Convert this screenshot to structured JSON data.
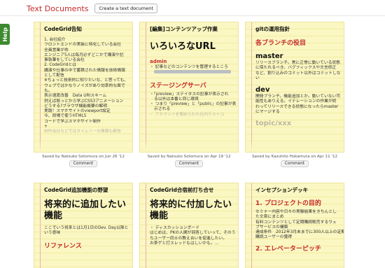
{
  "help_tab": {
    "label": "Help"
  },
  "header": {
    "title": "Text Documents",
    "create_button": "Create a text document"
  },
  "cards": [
    {
      "title": "CodeGrid告知",
      "lines": [
        "1. 会社紹介",
        "フロントエンドの実装に特化している会社",
        "全員営業が命",
        "エンジニア5人は毎月必ずどこかで講演や記",
        "事執筆をしている会社",
        "2. CodeGridとは",
        "講演や仕事の中で蓄積された情報を技術情報",
        "として配信",
        "※ちょっと技術的に知りたいな、と思っても、",
        "ウェブではかなりノイズがあり効率的な面で",
        "も。",
        "表示速度改善　Data URIスキーム",
        "例えば既っとから学ぶCSS3アニメーション",
        "どうする?ブラウザ機能概要の解明",
        "実践！スマホサイトのviewport設定",
        "今、即場で使うHTML5",
        "コードで学ぶスマホサイト制作",
        "+",
        "制作会社などではタイムリーな情報も配信"
      ],
      "saved_by": "Saved by Natsuko Sotomura on Jun 26 '12",
      "comment": "Comment"
    },
    {
      "title": "[編集]コンテンツアップ作業",
      "heading": "いろいろなURL",
      "admin_label": "admin",
      "admin_line": "・ 記事などのコンテンツを管理するところ",
      "section": "ステージングサーバ",
      "bullets": [
        "・「preview」ステイタスの記事が表示され",
        "る以外は本番と同じ環境",
        "・ つまり「preview」と「public」の記事が表",
        "示される",
        "・ アカウントを閉められた社内テストコ"
      ],
      "saved_by": "Saved by Natsuko Sotomura on Apr 19 '12",
      "comment": "Comment"
    },
    {
      "title": "gitの運用指針",
      "section": "各ブランチの役目",
      "master_heading": "master",
      "master_lines": [
        "リリースブランチ。常に正常に動いている状態",
        "に保たれるべき。バグフィックスや文言修正",
        "など、割り込みのコミット以外はコミットしな",
        "い"
      ],
      "dev_heading": "dev",
      "dev_lines": [
        "開発ブランチ。機能追加とか。動いていない可",
        "能性もありえる。イテレーションの作業が終",
        "わってリリースできる状態になったらmaster",
        "にマージする"
      ],
      "topic_heading": "topic/xxx",
      "saved_by": "Saved by Kazuhito Hokamura on Apr 11 '12",
      "comment": "Comment"
    },
    {
      "title": "CodeGrid追加機能の野望",
      "heading": "将来的に追加したい機能",
      "lines": [
        "ここでいう将来とは1月1日のDev. Day以降と",
        "いう意味"
      ],
      "section": "リファレンス"
    },
    {
      "title": "CodeGrid合宿前打ち合せ",
      "heading": "将来的に付加したい機能",
      "lines": [
        "・ ディスカッションボード",
        "はじめは、PKの人間が回答していって、そのう",
        "ちユーザー同士の教え合いを促進したい。",
        "お茶ゲと打スレッドもはしいかも。..."
      ]
    },
    {
      "title": "インセプションデッキ",
      "section": "1. プロジェクトの目的",
      "lines": [
        "セミナー内容や日々の実験結果をきちんとし",
        "た文章にまとめ",
        "有料コンテンツとして定期購読販売するウェ",
        "ブサービスの構築",
        "達成条件　2012年3月末までに300人以上の定期",
        "購読ユーザーの獲得"
      ],
      "section2": "2. エレベーターピッチ"
    }
  ]
}
